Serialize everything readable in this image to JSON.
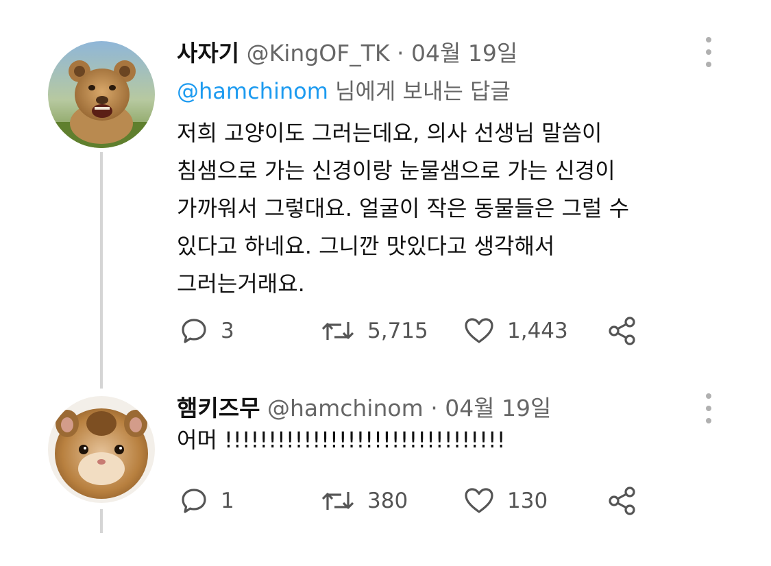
{
  "colors": {
    "mention": "#1d9bf0",
    "muted": "#666666",
    "text": "#111111",
    "thread_line": "#d5d5d5",
    "icon": "#555555"
  },
  "tweets": [
    {
      "author": {
        "display_name": "사자기",
        "handle": "@KingOF_TK",
        "avatar": "lion-cub-photo"
      },
      "separator": "·",
      "date": "04월 19일",
      "reply_to": {
        "mention": "@hamchinom",
        "suffix": " 님에게 보내는 답글"
      },
      "lines": [
        "저희 고양이도 그러는데요, 의사 선생님 말씀이",
        "침샘으로 가는 신경이랑 눈물샘으로 가는 신경이",
        "가까워서 그렇대요. 얼굴이 작은 동물들은 그럴 수",
        "있다고 하네요. 그니깐 맛있다고 생각해서",
        "그러는거래요."
      ],
      "stats": {
        "replies": "3",
        "retweets": "5,715",
        "likes": "1,443"
      },
      "icons": [
        "reply-icon",
        "retweet-icon",
        "like-icon",
        "share-icon",
        "more-options-icon"
      ]
    },
    {
      "author": {
        "display_name": "햄키즈무",
        "handle": "@hamchinom",
        "avatar": "hamster-photo"
      },
      "separator": "·",
      "date": "04월 19일",
      "lines": [
        "어머 !!!!!!!!!!!!!!!!!!!!!!!!!!!!!!!!"
      ],
      "stats": {
        "replies": "1",
        "retweets": "380",
        "likes": "130"
      },
      "icons": [
        "reply-icon",
        "retweet-icon",
        "like-icon",
        "share-icon",
        "more-options-icon"
      ]
    }
  ]
}
